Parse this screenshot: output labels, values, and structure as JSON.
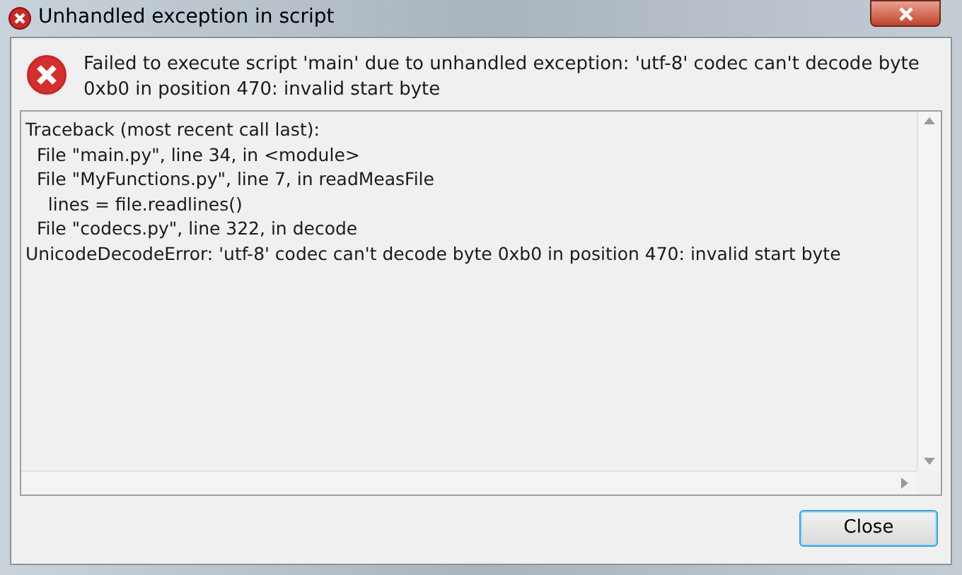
{
  "window": {
    "title": "Unhandled exception in script"
  },
  "message": "Failed to execute script 'main' due to unhandled exception: 'utf-8' codec can't decode byte 0xb0 in position 470: invalid start byte",
  "traceback": [
    "Traceback (most recent call last):",
    "  File \"main.py\", line 34, in <module>",
    "  File \"MyFunctions.py\", line 7, in readMeasFile",
    "    lines = file.readlines()",
    "  File \"codecs.py\", line 322, in decode",
    "UnicodeDecodeError: 'utf-8' codec can't decode byte 0xb0 in position 470: invalid start byte"
  ],
  "buttons": [
    {
      "label": "Close",
      "focused": true
    }
  ]
}
